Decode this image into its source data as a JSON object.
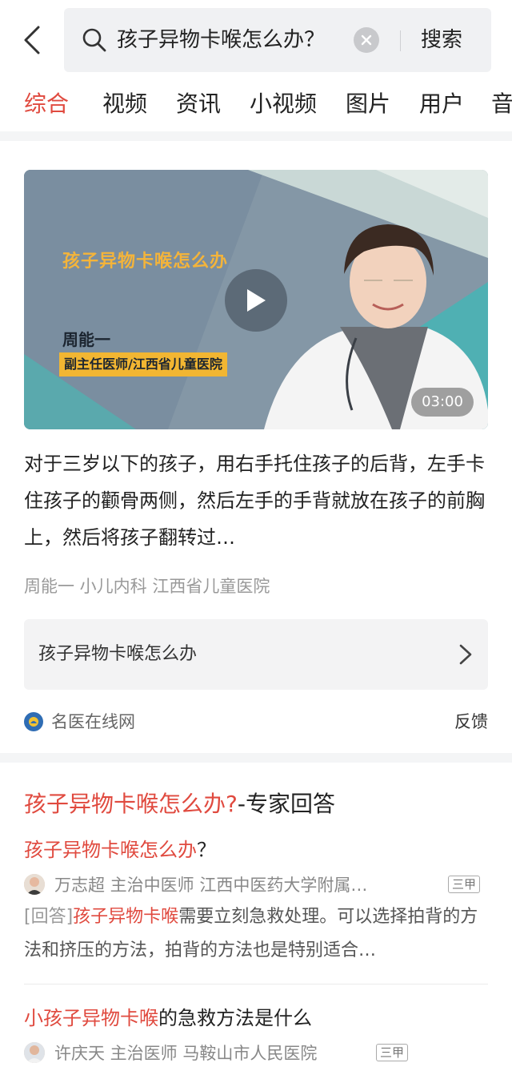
{
  "search": {
    "query": "孩子异物卡喉怎么办？",
    "button": "搜索"
  },
  "tabs": [
    "综合",
    "视频",
    "资讯",
    "小视频",
    "图片",
    "用户",
    "音"
  ],
  "video_card": {
    "thumb_title": "孩子异物卡喉怎么办",
    "thumb_name": "周能一",
    "thumb_role": "副主任医师/江西省儿童医院",
    "duration": "03:00",
    "description": "对于三岁以下的孩子，用右手托住孩子的后背，左手卡住孩子的颧骨两侧，然后左手的手背就放在孩子的前胸上，然后将孩子翻转过…",
    "meta": "周能一 小儿内科 江西省儿童医院",
    "related": "孩子异物卡喉怎么办",
    "source": "名医在线网",
    "feedback": "反馈"
  },
  "expert": {
    "title_highlight": "孩子异物卡喉怎么办?",
    "title_rest": "-专家回答",
    "q1": {
      "highlight": "孩子异物卡喉怎么办",
      "rest": "？",
      "doctor": "万志超 主治中医师 江西中医药大学附属…",
      "badge": "三甲",
      "answer_tag": "[回答]",
      "answer_highlight": "孩子异物卡喉",
      "answer_rest": "需要立刻急救处理。可以选择拍背的方法和挤压的方法，拍背的方法也是特别适合…"
    },
    "q2": {
      "highlight": "小孩子异物卡喉",
      "rest": "的急救方法是什么",
      "doctor": "许庆天 主治医师 马鞍山市人民医院",
      "badge": "三甲"
    }
  },
  "colors": {
    "accent": "#e04a3f",
    "thumb_title": "#f4b43a",
    "thumb_role_bg": "#f2b632"
  }
}
